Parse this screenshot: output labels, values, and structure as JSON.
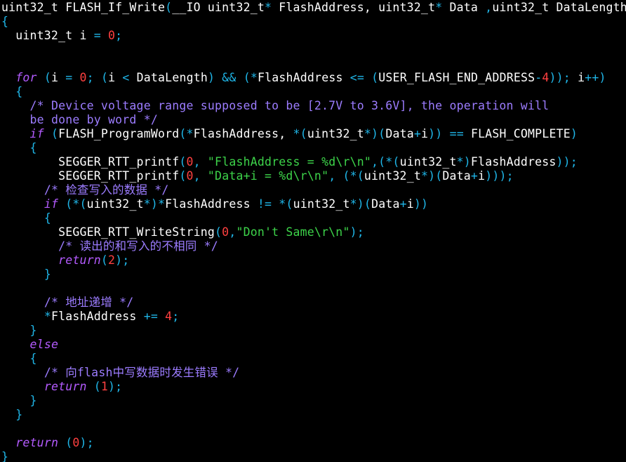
{
  "editor": {
    "lines": [
      [
        {
          "t": "text",
          "v": "uint32_t FLASH_If_Write"
        },
        {
          "t": "punct",
          "v": "("
        },
        {
          "t": "text",
          "v": "__IO uint32_t"
        },
        {
          "t": "punct",
          "v": "*"
        },
        {
          "t": "text",
          "v": " FlashAddress, uint32_t"
        },
        {
          "t": "punct",
          "v": "*"
        },
        {
          "t": "text",
          "v": " Data "
        },
        {
          "t": "punct",
          "v": ","
        },
        {
          "t": "text",
          "v": "uint32_t DataLength"
        },
        {
          "t": "punct",
          "v": ")"
        }
      ],
      [
        {
          "t": "punct",
          "v": "{"
        }
      ],
      [
        {
          "t": "text",
          "v": "  uint32_t i "
        },
        {
          "t": "punct",
          "v": "="
        },
        {
          "t": "text",
          "v": " "
        },
        {
          "t": "number",
          "v": "0"
        },
        {
          "t": "punct",
          "v": ";"
        }
      ],
      [],
      [],
      [
        {
          "t": "text",
          "v": "  "
        },
        {
          "t": "keyword",
          "v": "for"
        },
        {
          "t": "text",
          "v": " "
        },
        {
          "t": "punct",
          "v": "("
        },
        {
          "t": "text",
          "v": "i "
        },
        {
          "t": "punct",
          "v": "="
        },
        {
          "t": "text",
          "v": " "
        },
        {
          "t": "number",
          "v": "0"
        },
        {
          "t": "punct",
          "v": ";"
        },
        {
          "t": "text",
          "v": " "
        },
        {
          "t": "punct",
          "v": "("
        },
        {
          "t": "text",
          "v": "i "
        },
        {
          "t": "punct",
          "v": "<"
        },
        {
          "t": "text",
          "v": " DataLength"
        },
        {
          "t": "punct",
          "v": ")"
        },
        {
          "t": "text",
          "v": " "
        },
        {
          "t": "punct",
          "v": "&&"
        },
        {
          "t": "text",
          "v": " "
        },
        {
          "t": "punct",
          "v": "(*"
        },
        {
          "t": "text",
          "v": "FlashAddress "
        },
        {
          "t": "punct",
          "v": "<="
        },
        {
          "t": "text",
          "v": " "
        },
        {
          "t": "punct",
          "v": "("
        },
        {
          "t": "text",
          "v": "USER_FLASH_END_ADDRESS"
        },
        {
          "t": "punct",
          "v": "-"
        },
        {
          "t": "number",
          "v": "4"
        },
        {
          "t": "punct",
          "v": "));"
        },
        {
          "t": "text",
          "v": " i"
        },
        {
          "t": "punct",
          "v": "++)"
        }
      ],
      [
        {
          "t": "text",
          "v": "  "
        },
        {
          "t": "punct",
          "v": "{"
        }
      ],
      [
        {
          "t": "text",
          "v": "    "
        },
        {
          "t": "comment",
          "v": "/* Device voltage range supposed to be [2.7V to 3.6V], the operation will"
        }
      ],
      [
        {
          "t": "text",
          "v": "    "
        },
        {
          "t": "comment",
          "v": "be done by word */"
        }
      ],
      [
        {
          "t": "text",
          "v": "    "
        },
        {
          "t": "keyword",
          "v": "if"
        },
        {
          "t": "text",
          "v": " "
        },
        {
          "t": "punct",
          "v": "("
        },
        {
          "t": "text",
          "v": "FLASH_ProgramWord"
        },
        {
          "t": "punct",
          "v": "(*"
        },
        {
          "t": "text",
          "v": "FlashAddress, "
        },
        {
          "t": "punct",
          "v": "*("
        },
        {
          "t": "text",
          "v": "uint32_t"
        },
        {
          "t": "punct",
          "v": "*)("
        },
        {
          "t": "text",
          "v": "Data"
        },
        {
          "t": "punct",
          "v": "+"
        },
        {
          "t": "text",
          "v": "i"
        },
        {
          "t": "punct",
          "v": "))"
        },
        {
          "t": "text",
          "v": " "
        },
        {
          "t": "punct",
          "v": "=="
        },
        {
          "t": "text",
          "v": " FLASH_COMPLETE"
        },
        {
          "t": "punct",
          "v": ")"
        }
      ],
      [
        {
          "t": "text",
          "v": "    "
        },
        {
          "t": "punct",
          "v": "{"
        }
      ],
      [
        {
          "t": "text",
          "v": "        SEGGER_RTT_printf"
        },
        {
          "t": "punct",
          "v": "("
        },
        {
          "t": "number",
          "v": "0"
        },
        {
          "t": "punct",
          "v": ","
        },
        {
          "t": "text",
          "v": " "
        },
        {
          "t": "string",
          "v": "\"FlashAddress = %d\\r\\n\""
        },
        {
          "t": "punct",
          "v": ",(*("
        },
        {
          "t": "text",
          "v": "uint32_t"
        },
        {
          "t": "punct",
          "v": "*)"
        },
        {
          "t": "text",
          "v": "FlashAddress"
        },
        {
          "t": "punct",
          "v": "));"
        }
      ],
      [
        {
          "t": "text",
          "v": "        SEGGER_RTT_printf"
        },
        {
          "t": "punct",
          "v": "("
        },
        {
          "t": "number",
          "v": "0"
        },
        {
          "t": "punct",
          "v": ","
        },
        {
          "t": "text",
          "v": " "
        },
        {
          "t": "string",
          "v": "\"Data+i = %d\\r\\n\""
        },
        {
          "t": "punct",
          "v": ","
        },
        {
          "t": "text",
          "v": " "
        },
        {
          "t": "punct",
          "v": "(*("
        },
        {
          "t": "text",
          "v": "uint32_t"
        },
        {
          "t": "punct",
          "v": "*)("
        },
        {
          "t": "text",
          "v": "Data"
        },
        {
          "t": "punct",
          "v": "+"
        },
        {
          "t": "text",
          "v": "i"
        },
        {
          "t": "punct",
          "v": ")));"
        }
      ],
      [
        {
          "t": "text",
          "v": "      "
        },
        {
          "t": "comment",
          "v": "/* 检查写入的数据 */"
        }
      ],
      [
        {
          "t": "text",
          "v": "      "
        },
        {
          "t": "keyword",
          "v": "if"
        },
        {
          "t": "text",
          "v": " "
        },
        {
          "t": "punct",
          "v": "(*("
        },
        {
          "t": "text",
          "v": "uint32_t"
        },
        {
          "t": "punct",
          "v": "*)*"
        },
        {
          "t": "text",
          "v": "FlashAddress "
        },
        {
          "t": "punct",
          "v": "!="
        },
        {
          "t": "text",
          "v": " "
        },
        {
          "t": "punct",
          "v": "*("
        },
        {
          "t": "text",
          "v": "uint32_t"
        },
        {
          "t": "punct",
          "v": "*)("
        },
        {
          "t": "text",
          "v": "Data"
        },
        {
          "t": "punct",
          "v": "+"
        },
        {
          "t": "text",
          "v": "i"
        },
        {
          "t": "punct",
          "v": "))"
        }
      ],
      [
        {
          "t": "text",
          "v": "      "
        },
        {
          "t": "punct",
          "v": "{"
        }
      ],
      [
        {
          "t": "text",
          "v": "        SEGGER_RTT_WriteString"
        },
        {
          "t": "punct",
          "v": "("
        },
        {
          "t": "number",
          "v": "0"
        },
        {
          "t": "punct",
          "v": ","
        },
        {
          "t": "string",
          "v": "\"Don't Same\\r\\n\""
        },
        {
          "t": "punct",
          "v": ");"
        }
      ],
      [
        {
          "t": "text",
          "v": "        "
        },
        {
          "t": "comment",
          "v": "/* 读出的和写入的不相同 */"
        }
      ],
      [
        {
          "t": "text",
          "v": "        "
        },
        {
          "t": "keyword",
          "v": "return"
        },
        {
          "t": "punct",
          "v": "("
        },
        {
          "t": "number",
          "v": "2"
        },
        {
          "t": "punct",
          "v": ");"
        }
      ],
      [
        {
          "t": "text",
          "v": "      "
        },
        {
          "t": "punct",
          "v": "}"
        }
      ],
      [],
      [
        {
          "t": "text",
          "v": "      "
        },
        {
          "t": "comment",
          "v": "/* 地址递增 */"
        }
      ],
      [
        {
          "t": "text",
          "v": "      "
        },
        {
          "t": "punct",
          "v": "*"
        },
        {
          "t": "text",
          "v": "FlashAddress "
        },
        {
          "t": "punct",
          "v": "+="
        },
        {
          "t": "text",
          "v": " "
        },
        {
          "t": "number",
          "v": "4"
        },
        {
          "t": "punct",
          "v": ";"
        }
      ],
      [
        {
          "t": "text",
          "v": "    "
        },
        {
          "t": "punct",
          "v": "}"
        }
      ],
      [
        {
          "t": "text",
          "v": "    "
        },
        {
          "t": "keyword",
          "v": "else"
        }
      ],
      [
        {
          "t": "text",
          "v": "    "
        },
        {
          "t": "punct",
          "v": "{"
        }
      ],
      [
        {
          "t": "text",
          "v": "      "
        },
        {
          "t": "comment",
          "v": "/* 向flash中写数据时发生错误 */"
        }
      ],
      [
        {
          "t": "text",
          "v": "      "
        },
        {
          "t": "keyword",
          "v": "return"
        },
        {
          "t": "text",
          "v": " "
        },
        {
          "t": "punct",
          "v": "("
        },
        {
          "t": "number",
          "v": "1"
        },
        {
          "t": "punct",
          "v": ");"
        }
      ],
      [
        {
          "t": "text",
          "v": "    "
        },
        {
          "t": "punct",
          "v": "}"
        }
      ],
      [
        {
          "t": "text",
          "v": "  "
        },
        {
          "t": "punct",
          "v": "}"
        }
      ],
      [],
      [
        {
          "t": "text",
          "v": "  "
        },
        {
          "t": "keyword",
          "v": "return"
        },
        {
          "t": "text",
          "v": " "
        },
        {
          "t": "punct",
          "v": "("
        },
        {
          "t": "number",
          "v": "0"
        },
        {
          "t": "punct",
          "v": ");"
        }
      ],
      [
        {
          "t": "punct",
          "v": "}"
        }
      ]
    ]
  }
}
